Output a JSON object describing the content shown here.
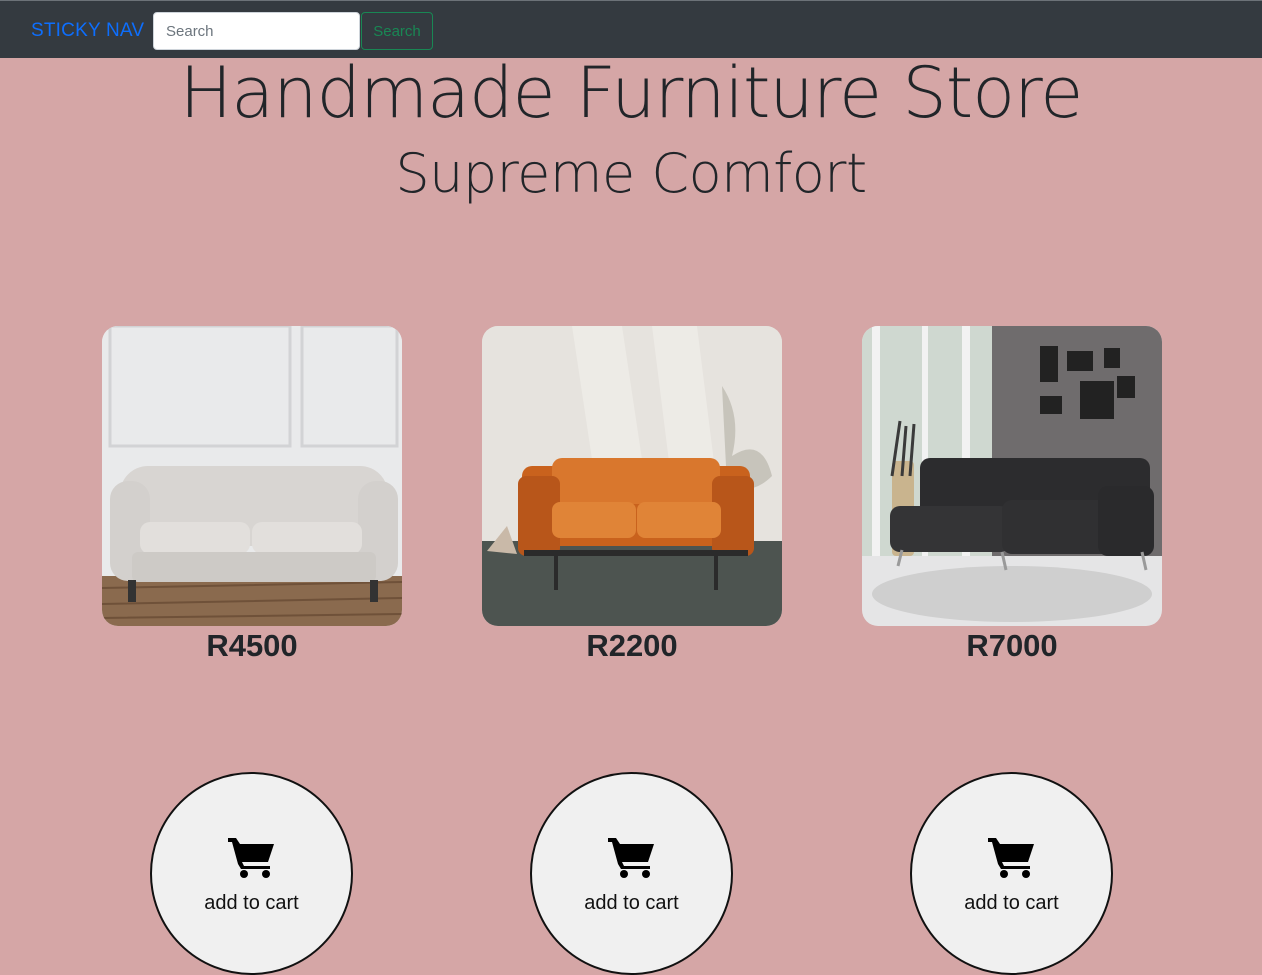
{
  "nav": {
    "brand": "STICKY NAV",
    "search_placeholder": "Search",
    "search_value": "",
    "search_button": "Search"
  },
  "hero": {
    "title": "Handmade Furniture Store",
    "subtitle": "Supreme Comfort"
  },
  "products": [
    {
      "name": "white-chesterfield-sofa",
      "price": "R4500",
      "cart_label": "add to cart"
    },
    {
      "name": "orange-leather-loveseat",
      "price": "R2200",
      "cart_label": "add to cart"
    },
    {
      "name": "black-sectional-sofa",
      "price": "R7000",
      "cart_label": "add to cart"
    }
  ],
  "icons": {
    "cart": "shopping-cart-icon"
  },
  "colors": {
    "background": "#d5a6a6",
    "navbar": "#343a40",
    "brand": "#0d6efd",
    "search_button": "#198754"
  }
}
